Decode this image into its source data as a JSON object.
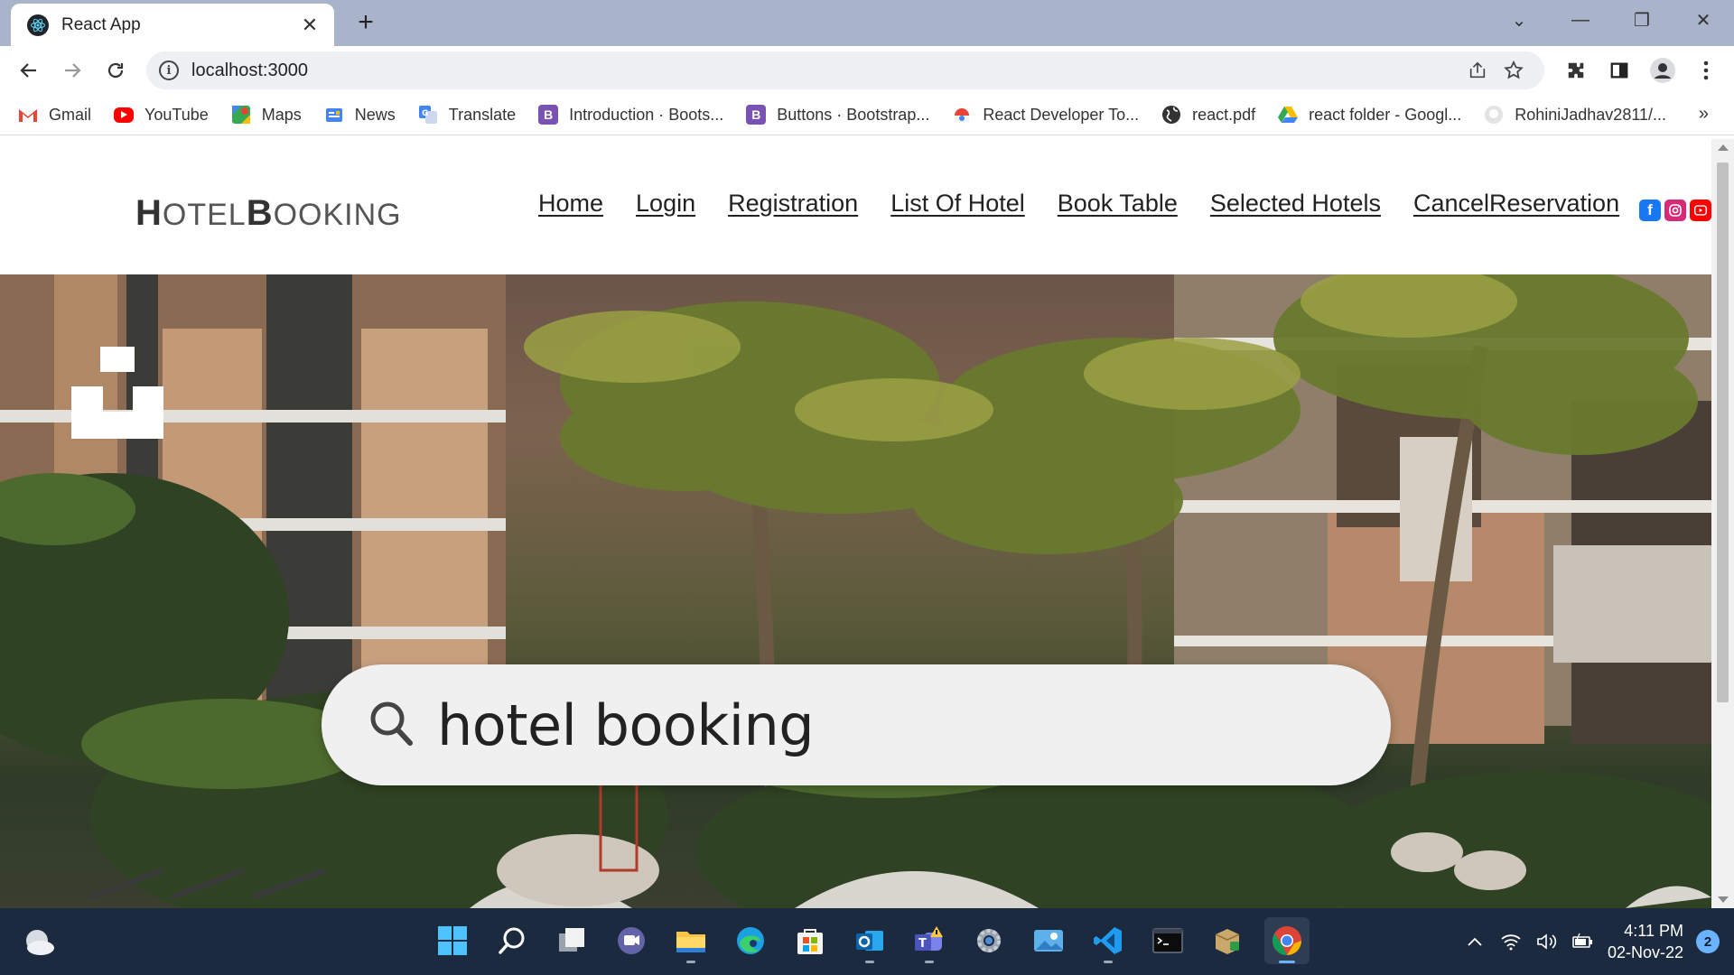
{
  "browser": {
    "tab_title": "React App",
    "url": "localhost:3000",
    "bookmarks": [
      {
        "label": "Gmail",
        "icon": "gmail-icon"
      },
      {
        "label": "YouTube",
        "icon": "youtube-icon"
      },
      {
        "label": "Maps",
        "icon": "maps-icon"
      },
      {
        "label": "News",
        "icon": "news-icon"
      },
      {
        "label": "Translate",
        "icon": "translate-icon"
      },
      {
        "label": "Introduction · Boots...",
        "icon": "bootstrap-icon"
      },
      {
        "label": "Buttons · Bootstrap...",
        "icon": "bootstrap-icon"
      },
      {
        "label": "React Developer To...",
        "icon": "chrome-web-store-icon"
      },
      {
        "label": "react.pdf",
        "icon": "globe-icon"
      },
      {
        "label": "react folder - Googl...",
        "icon": "google-drive-icon"
      },
      {
        "label": "RohiniJadhav2811/...",
        "icon": "github-icon"
      }
    ],
    "bookmarks_more": "»"
  },
  "site": {
    "logo_h": "H",
    "logo_otel": "OTEL",
    "logo_b": "B",
    "logo_ooking": "OOKING",
    "nav": [
      "Home",
      "Login",
      "Registration",
      "List Of Hotel",
      "Book Table",
      "Selected Hotels",
      "CancelReservation"
    ],
    "hero_search_text": "hotel booking"
  },
  "taskbar": {
    "time": "4:11 PM",
    "date": "02-Nov-22",
    "notification_count": "2"
  },
  "colors": {
    "tabstrip": "#a9b3c9",
    "taskbar": "#1c2a3f",
    "facebook": "#1877f2",
    "instagram": "#d62976",
    "youtube": "#ff0000"
  }
}
